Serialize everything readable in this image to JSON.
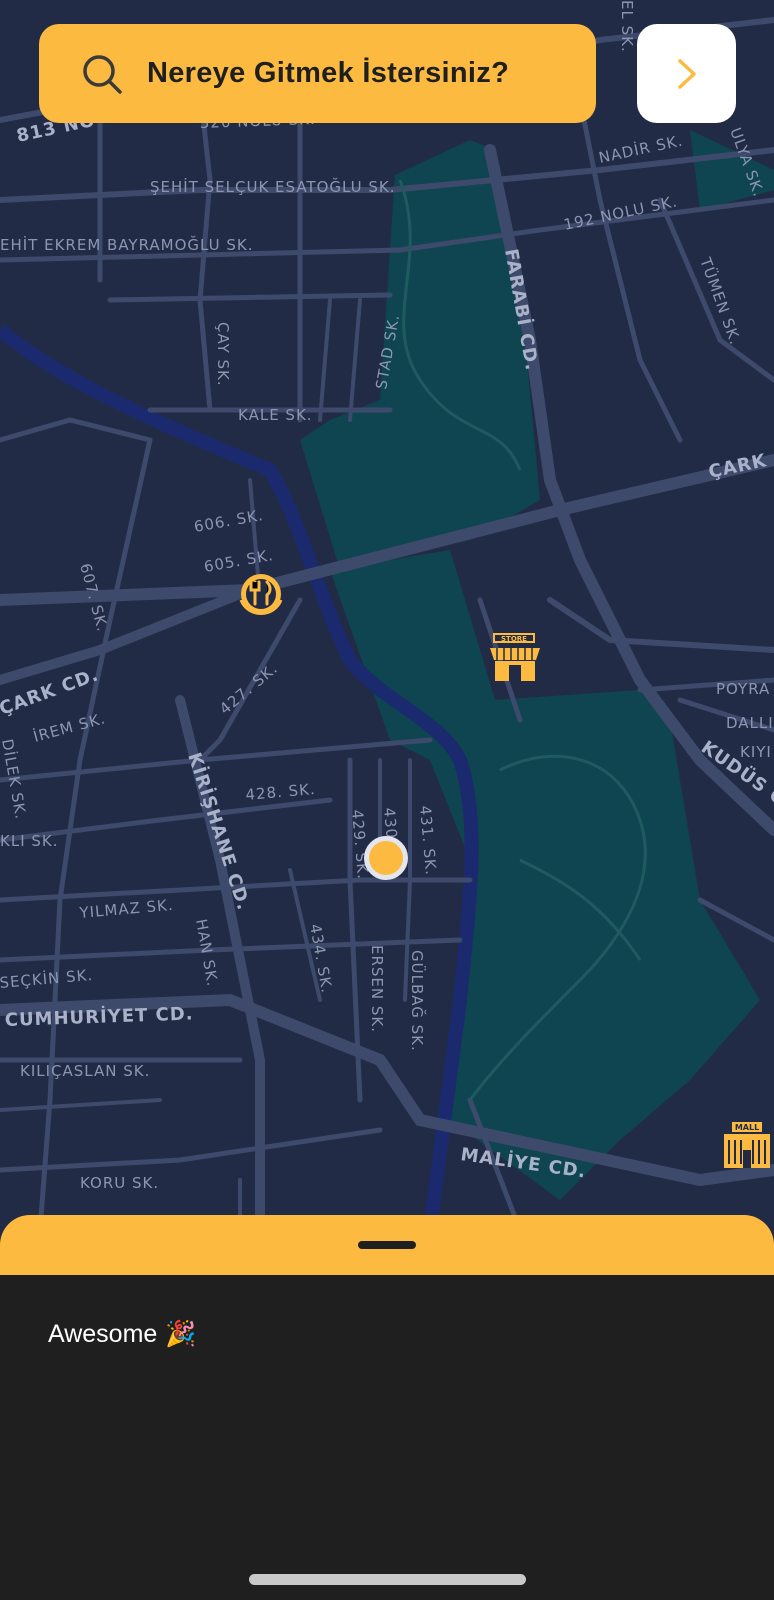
{
  "search": {
    "placeholder": "Nereye Gitmek İstersiniz?"
  },
  "streets": [
    "813 NO",
    "520 NOLU SK.",
    "ŞEHİT SELÇUK ESATOĞLU SK.",
    "EHİT EKREM BAYRAMOĞLU SK.",
    "NADİR SK.",
    "192 NOLU SK.",
    "FARABİ CD.",
    "ÇAY SK.",
    "STAD SK.",
    "KALE SK.",
    "ÇARK",
    "606. SK.",
    "605. SK.",
    "607. SK.",
    "ÇARK CD.",
    "İREM SK.",
    "DİLEK SK.",
    "427. SK.",
    "KİRİŞHANE CD.",
    "428. SK.",
    "429. SK.",
    "430",
    "431. SK.",
    "YILMAZ SK.",
    "HAN SK.",
    "434. SK.",
    "ERSEN SK.",
    "GÜLBAĞ SK.",
    "SEÇKİN SK.",
    "CUMHURİYET CD.",
    "KILIÇASLAN SK.",
    "MALİYE CD.",
    "KORU SK.",
    "TÜMEN SK.",
    "POYRA",
    "DALLI",
    "KIYI",
    "KUDÜS C",
    "KLI SK.",
    "ULYA SK.",
    "EL SK."
  ],
  "pois": {
    "store_label": "STORE",
    "mall_label": "MALL"
  },
  "sheet": {
    "message": "Awesome",
    "message_emoji": "🎉"
  },
  "colors": {
    "accent": "#fcbb40",
    "map_background": "#222b45",
    "road": "#3d4a6b",
    "park": "#0e4550",
    "river": "#1b2a6e",
    "sheet_background": "#1f1f1f"
  }
}
